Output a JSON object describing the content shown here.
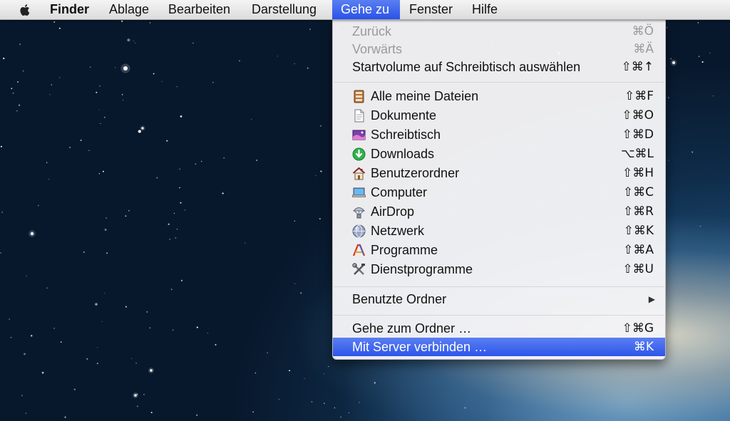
{
  "menubar": {
    "apple_icon": "apple-logo-icon",
    "items": [
      {
        "label": "Finder"
      },
      {
        "label": "Ablage"
      },
      {
        "label": "Bearbeiten"
      },
      {
        "label": "Darstellung"
      },
      {
        "label": "Gehe zu"
      },
      {
        "label": "Fenster"
      },
      {
        "label": "Hilfe"
      }
    ],
    "active_item": "Gehe zu"
  },
  "menu": {
    "nav": [
      {
        "label": "Zurück",
        "shortcut": "⌘Ö",
        "enabled": false
      },
      {
        "label": "Vorwärts",
        "shortcut": "⌘Ä",
        "enabled": false
      },
      {
        "label": "Startvolume auf Schreibtisch auswählen",
        "shortcut": "⇧⌘↑",
        "enabled": true
      }
    ],
    "places": [
      {
        "label": "Alle meine Dateien",
        "shortcut": "⇧⌘F",
        "icon": "all-files-icon"
      },
      {
        "label": "Dokumente",
        "shortcut": "⇧⌘O",
        "icon": "document-icon"
      },
      {
        "label": "Schreibtisch",
        "shortcut": "⇧⌘D",
        "icon": "desktop-icon"
      },
      {
        "label": "Downloads",
        "shortcut": "⌥⌘L",
        "icon": "downloads-icon"
      },
      {
        "label": "Benutzerordner",
        "shortcut": "⇧⌘H",
        "icon": "home-icon"
      },
      {
        "label": "Computer",
        "shortcut": "⇧⌘C",
        "icon": "computer-icon"
      },
      {
        "label": "AirDrop",
        "shortcut": "⇧⌘R",
        "icon": "airdrop-icon"
      },
      {
        "label": "Netzwerk",
        "shortcut": "⇧⌘K",
        "icon": "network-icon"
      },
      {
        "label": "Programme",
        "shortcut": "⇧⌘A",
        "icon": "applications-icon"
      },
      {
        "label": "Dienstprogramme",
        "shortcut": "⇧⌘U",
        "icon": "utilities-icon"
      }
    ],
    "recent": {
      "label": "Benutzte Ordner",
      "submenu_icon": "submenu-arrow-icon"
    },
    "folder": [
      {
        "label": "Gehe zum Ordner …",
        "shortcut": "⇧⌘G"
      },
      {
        "label": "Mit Server verbinden …",
        "shortcut": "⌘K",
        "highlighted": true
      }
    ]
  },
  "colors": {
    "menu_highlight": "#2d55ea",
    "disabled_text": "#9a9a9a"
  }
}
